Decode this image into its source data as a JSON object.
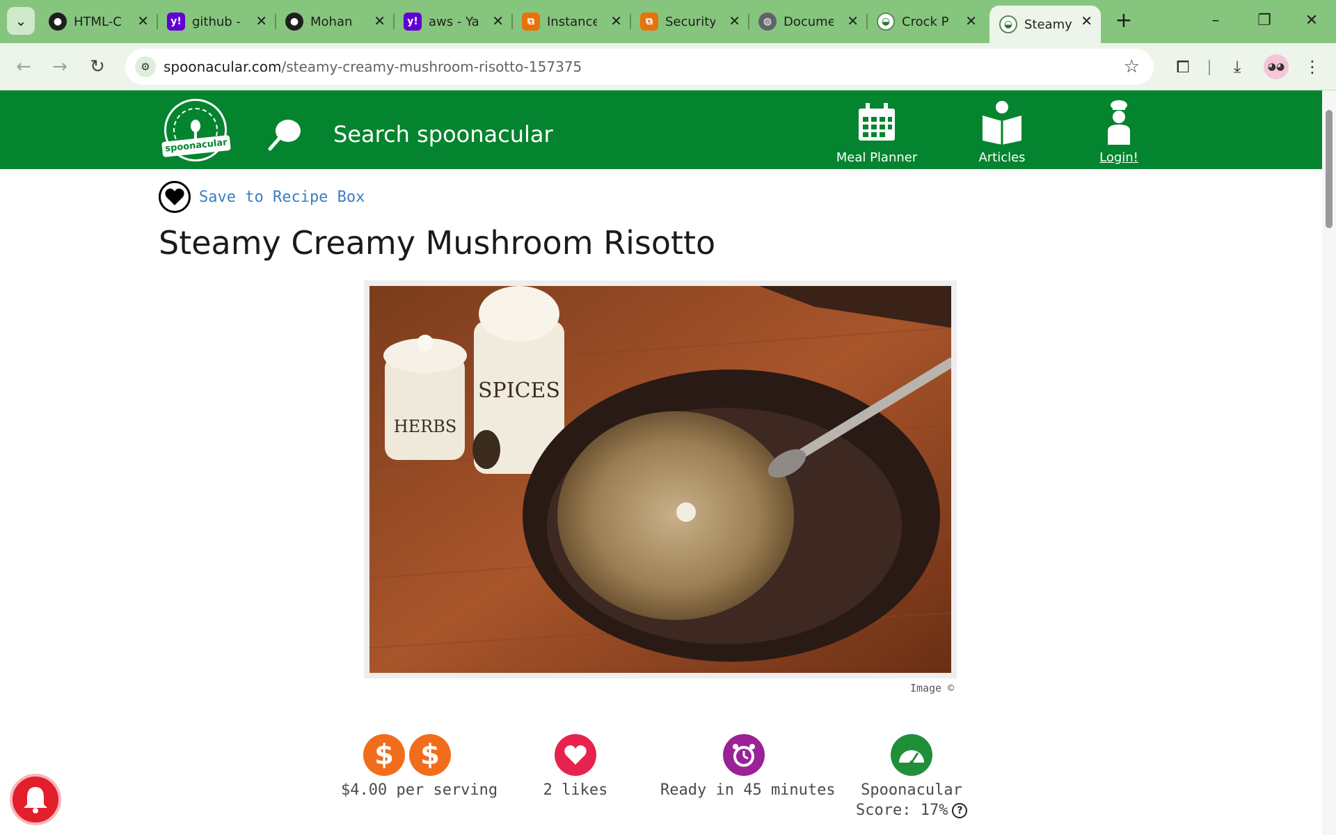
{
  "browser": {
    "tabs": [
      {
        "label": "HTML-C",
        "favicon": "github-icon"
      },
      {
        "label": "github -",
        "favicon": "yahoo-icon"
      },
      {
        "label": "Mohan",
        "favicon": "github-icon"
      },
      {
        "label": "aws - Ya",
        "favicon": "yahoo-icon"
      },
      {
        "label": "Instance",
        "favicon": "aws-icon"
      },
      {
        "label": "Security",
        "favicon": "aws-icon"
      },
      {
        "label": "Docume",
        "favicon": "globe-icon"
      },
      {
        "label": "Crock P",
        "favicon": "spoonacular-icon"
      },
      {
        "label": "Steamy",
        "favicon": "spoonacular-icon"
      }
    ],
    "active_tab_index": 8,
    "address": {
      "domain": "spoonacular.com",
      "path": "/steamy-creamy-mushroom-risotto-157375"
    }
  },
  "site": {
    "logo_text": "spoonacular",
    "search_placeholder": "Search spoonacular",
    "nav": {
      "meal_planner": "Meal Planner",
      "articles": "Articles",
      "login": "Login!"
    },
    "colors": {
      "brand_green": "#05842f",
      "link_blue": "#3a7fc1"
    }
  },
  "recipe": {
    "save_label": "Save to Recipe Box",
    "title": "Steamy Creamy Mushroom Risotto",
    "image_credit": "Image ©",
    "stats": {
      "price": {
        "label": "$4.00 per serving",
        "icon_symbol": "$",
        "color": "#f26d1b"
      },
      "likes": {
        "label": "2 likes",
        "color": "#e8224f"
      },
      "time": {
        "label": "Ready in 45 minutes",
        "color": "#9b2196"
      },
      "score": {
        "label_line1": "Spoonacular",
        "label_line2": "Score: 17%",
        "help": "?",
        "color": "#1f8f3a"
      }
    }
  }
}
